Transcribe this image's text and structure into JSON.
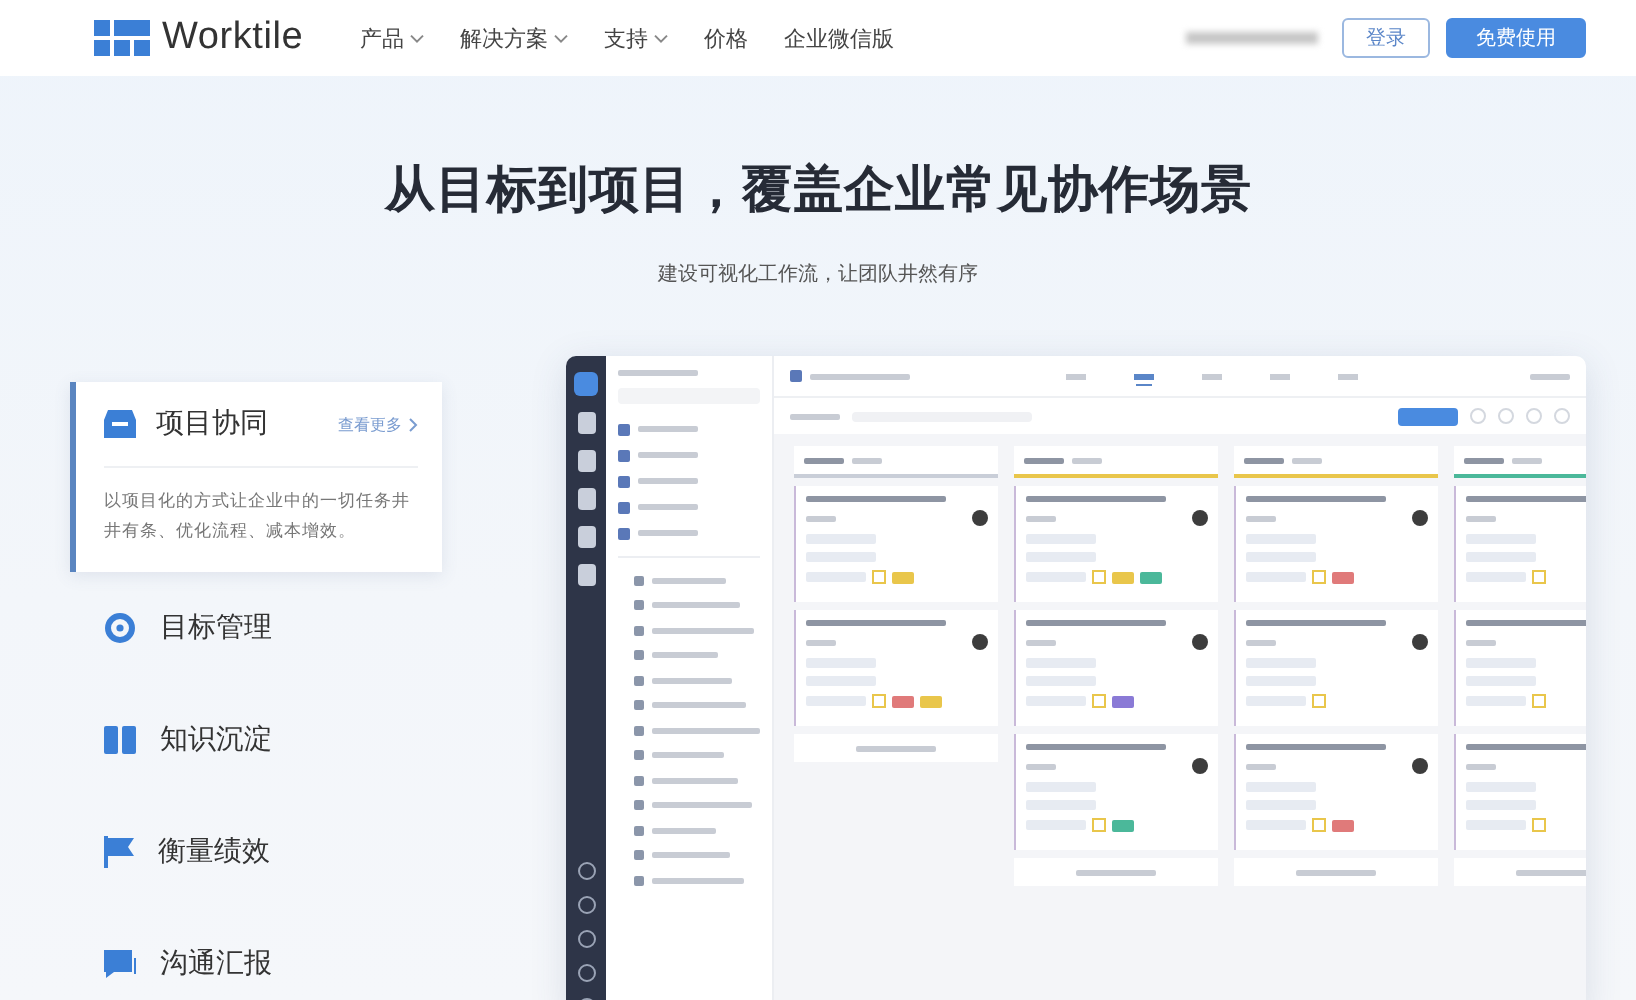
{
  "nav": {
    "logo": "Worktile",
    "items": [
      {
        "label": "产品",
        "has_menu": true
      },
      {
        "label": "解决方案",
        "has_menu": true
      },
      {
        "label": "支持",
        "has_menu": true
      },
      {
        "label": "价格",
        "has_menu": false
      },
      {
        "label": "企业微信版",
        "has_menu": false
      }
    ],
    "buttons": [
      {
        "label": "登录",
        "kind": "outline"
      },
      {
        "label": "免费使用",
        "kind": "primary"
      }
    ]
  },
  "hero": {
    "title": "从目标到项目，覆盖企业常见协作场景",
    "subtitle": "建设可视化工作流，让团队井然有序"
  },
  "features": [
    {
      "label": "项目协同",
      "selected": true,
      "link": "查看更多",
      "description": "以项目化的方式让企业中的一切任务井井有条、优化流程、减本增效。"
    },
    {
      "label": "目标管理",
      "selected": false
    },
    {
      "label": "知识沉淀",
      "selected": false
    },
    {
      "label": "衡量绩效",
      "selected": false
    },
    {
      "label": "沟通汇报",
      "selected": false
    }
  ]
}
